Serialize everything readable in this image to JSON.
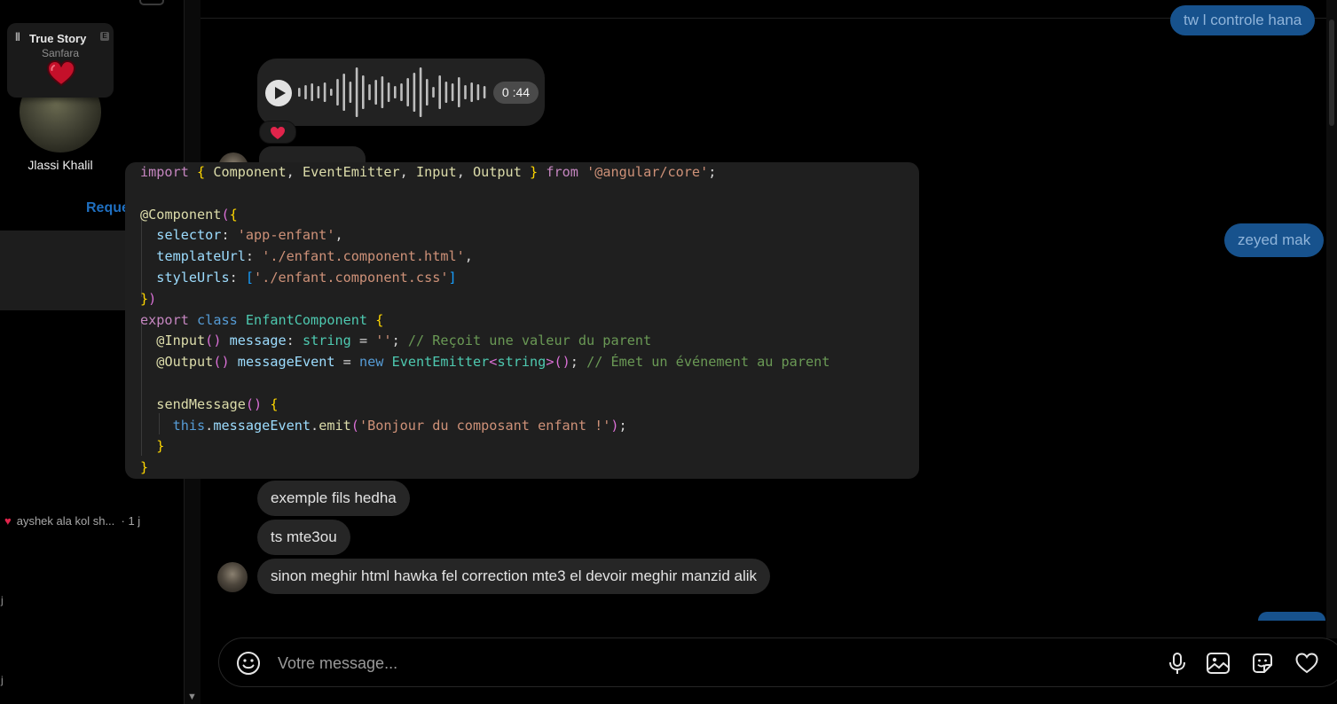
{
  "sidebar": {
    "story": {
      "title": "True Story",
      "artist": "Sanfara",
      "explicit": "E"
    },
    "profile_name": "Jlassi Khalil",
    "requests_label": "Reque",
    "conversation_preview": {
      "text": "ayshek ala kol sh...",
      "time": "· 1 j"
    },
    "edge_letters": [
      "j",
      "j"
    ]
  },
  "chat": {
    "messages_out": [
      "tw l controle hana",
      "zeyed mak"
    ],
    "voice": {
      "duration": "0 :44",
      "reaction": "heart"
    },
    "messages_in": [
      "exemple fils hedha",
      "ts mte3ou",
      "sinon meghir html hawka fel correction mte3 el devoir meghir manzid alik"
    ]
  },
  "code_snippet": {
    "language": "typescript",
    "lines": [
      "import { Component, EventEmitter, Input, Output } from '@angular/core';",
      "",
      "@Component({",
      "  selector: 'app-enfant',",
      "  templateUrl: './enfant.component.html',",
      "  styleUrls: ['./enfant.component.css']",
      "})",
      "export class EnfantComponent {",
      "  @Input() message: string = ''; // Reçoit une valeur du parent",
      "  @Output() messageEvent = new EventEmitter<string>(); // Émet un événement au parent",
      "",
      "  sendMessage() {",
      "    this.messageEvent.emit('Bonjour du composant enfant !');",
      "  }",
      "}"
    ]
  },
  "composer": {
    "placeholder": "Votre message...",
    "icons": [
      "emoji-icon",
      "microphone-icon",
      "image-icon",
      "sticker-icon",
      "heart-icon"
    ]
  },
  "colors": {
    "outgoing_bubble": "#17528d",
    "incoming_bubble": "#262626",
    "accent": "#1f6fc0",
    "heart": "#e0244b"
  }
}
